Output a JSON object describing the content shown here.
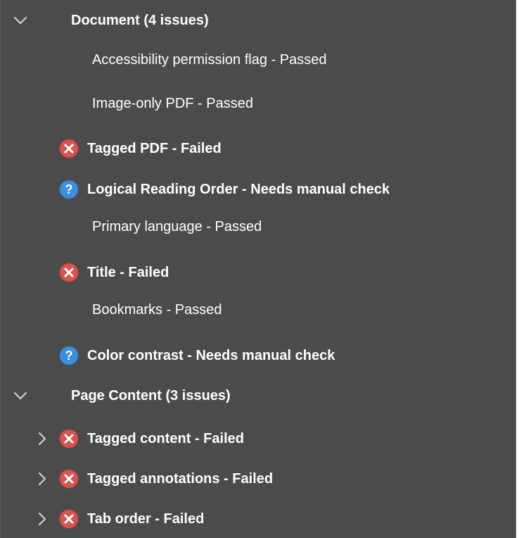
{
  "sections": [
    {
      "title": "Document (4 issues)",
      "expanded": true,
      "items": [
        {
          "label": "Accessibility permission flag - Passed",
          "status": "passed"
        },
        {
          "label": "Image-only PDF - Passed",
          "status": "passed"
        },
        {
          "label": "Tagged PDF - Failed",
          "status": "failed"
        },
        {
          "label": "Logical Reading Order - Needs manual check",
          "status": "manual"
        },
        {
          "label": "Primary language - Passed",
          "status": "passed"
        },
        {
          "label": "Title - Failed",
          "status": "failed"
        },
        {
          "label": "Bookmarks - Passed",
          "status": "passed"
        },
        {
          "label": "Color contrast - Needs manual check",
          "status": "manual"
        }
      ]
    },
    {
      "title": "Page Content (3 issues)",
      "expanded": true,
      "items": [
        {
          "label": "Tagged content - Failed",
          "status": "failed",
          "expandable": true
        },
        {
          "label": "Tagged annotations - Failed",
          "status": "failed",
          "expandable": true
        },
        {
          "label": "Tab order - Failed",
          "status": "failed",
          "expandable": true
        }
      ]
    }
  ],
  "icons": {
    "failed": "failed-x-icon",
    "manual": "question-mark-icon",
    "expand_down": "chevron-down-icon",
    "collapsed": "chevron-right-icon"
  },
  "colors": {
    "panel_bg": "#4b4b4b",
    "text": "#ffffff",
    "failed_icon": "#d9534f",
    "manual_icon": "#3b8fe0",
    "chevron": "#cfcfcf"
  }
}
